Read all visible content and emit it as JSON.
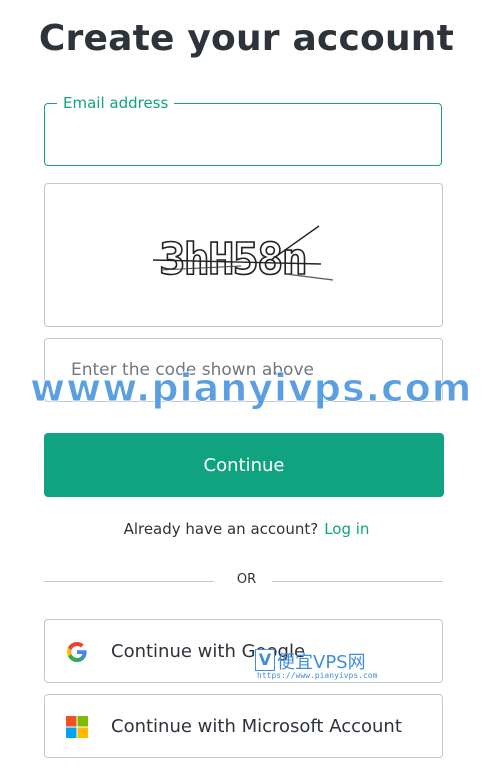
{
  "title": "Create your account",
  "email": {
    "label": "Email address",
    "value": ""
  },
  "captcha": {
    "text": "3hH58n"
  },
  "code": {
    "placeholder": "Enter the code shown above",
    "value": ""
  },
  "continue_label": "Continue",
  "login_prompt": "Already have an account?",
  "login_link": "Log in",
  "divider_text": "OR",
  "social": {
    "google_label": "Continue with Google",
    "google_icon": "google-icon",
    "microsoft_label": "Continue with Microsoft Account",
    "microsoft_icon": "microsoft-icon"
  },
  "watermark": {
    "main": "www.pianyivps.com",
    "badge_letter": "V",
    "badge_text": "便宜VPS网",
    "badge_url": "https://www.pianyivps.com"
  },
  "colors": {
    "accent": "#10a37f",
    "text": "#2d333a",
    "border": "#c2c8d0",
    "watermark": "#3f8ede"
  }
}
